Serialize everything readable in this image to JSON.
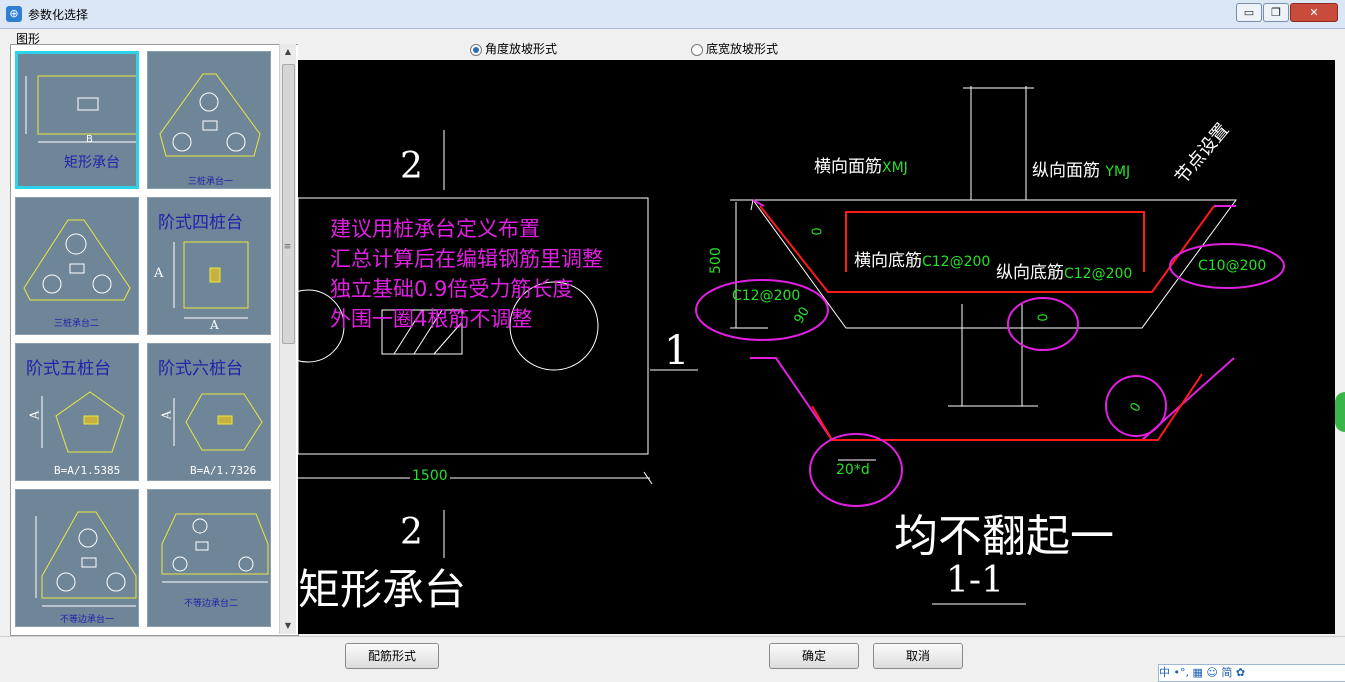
{
  "window": {
    "title": "参数化选择",
    "icon": "app-icon",
    "controls": [
      "minimize-icon",
      "restore-icon",
      "close-icon"
    ]
  },
  "shape_group": {
    "label": "图形"
  },
  "thumbnails": [
    {
      "id": "rect",
      "caption": "矩形承台",
      "text_b": "B",
      "selected": true
    },
    {
      "id": "tri1",
      "caption": "三桩承台一",
      "selected": false
    },
    {
      "id": "tri2",
      "caption": "三桩承台二",
      "selected": false
    },
    {
      "id": "step4",
      "caption": "阶式四桩台",
      "text_a": "A",
      "selected": false
    },
    {
      "id": "step5",
      "caption": "阶式五桩台",
      "text_a": "A",
      "formula": "B=A/1.5385",
      "selected": false
    },
    {
      "id": "step6",
      "caption": "阶式六桩台",
      "text_a": "A",
      "formula": "B=A/1.7326",
      "selected": false
    },
    {
      "id": "uneq1",
      "caption": "不等边承台一",
      "selected": false
    },
    {
      "id": "uneq2",
      "caption": "不等边承台二",
      "selected": false
    }
  ],
  "slope_options": [
    {
      "label": "角度放坡形式",
      "checked": true
    },
    {
      "label": "底宽放坡形式",
      "checked": false
    }
  ],
  "drawing": {
    "section_mark_top": "2",
    "section_mark_bottom": "2",
    "section_mark_side": "1",
    "shape_name": "矩形承台",
    "dim_width": "1500",
    "notes": [
      "建议用桩承台定义布置",
      "汇总计算后在编辑钢筋里调整",
      "独立基础0.9倍受力筋长度",
      "外围一圈4根筋不调整"
    ],
    "label_top_transverse": "横向面筋",
    "label_top_transverse_code": "XMJ",
    "label_top_longitudinal": "纵向面筋",
    "label_top_longitudinal_code": "YMJ",
    "label_node_setting": "节点设置",
    "label_bottom_transverse": "横向底筋",
    "label_bottom_transverse_value": "C12@200",
    "label_bottom_longitudinal": "纵向底筋",
    "label_bottom_longitudinal_value": "C12@200",
    "label_left_rebar": "C12@200",
    "label_right_rebar": "C10@200",
    "dim_height": "500",
    "dim_zero": "0",
    "dim_ninety": "90",
    "dim_anchor": "20*d",
    "note_no_bend": "均不翻起一",
    "section_title": "1-1"
  },
  "buttons": {
    "rebar_form": "配筋形式",
    "ok": "确定",
    "cancel": "取消"
  },
  "ime": {
    "text": "中 •°, ▦ ☺ 简 ✿"
  },
  "colors": {
    "canvas_bg": "#000000",
    "red_rebar": "#ff1a1a",
    "magenta": "#e020e0",
    "green_text": "#28e028",
    "cyan_selection": "#2ed3e8"
  }
}
